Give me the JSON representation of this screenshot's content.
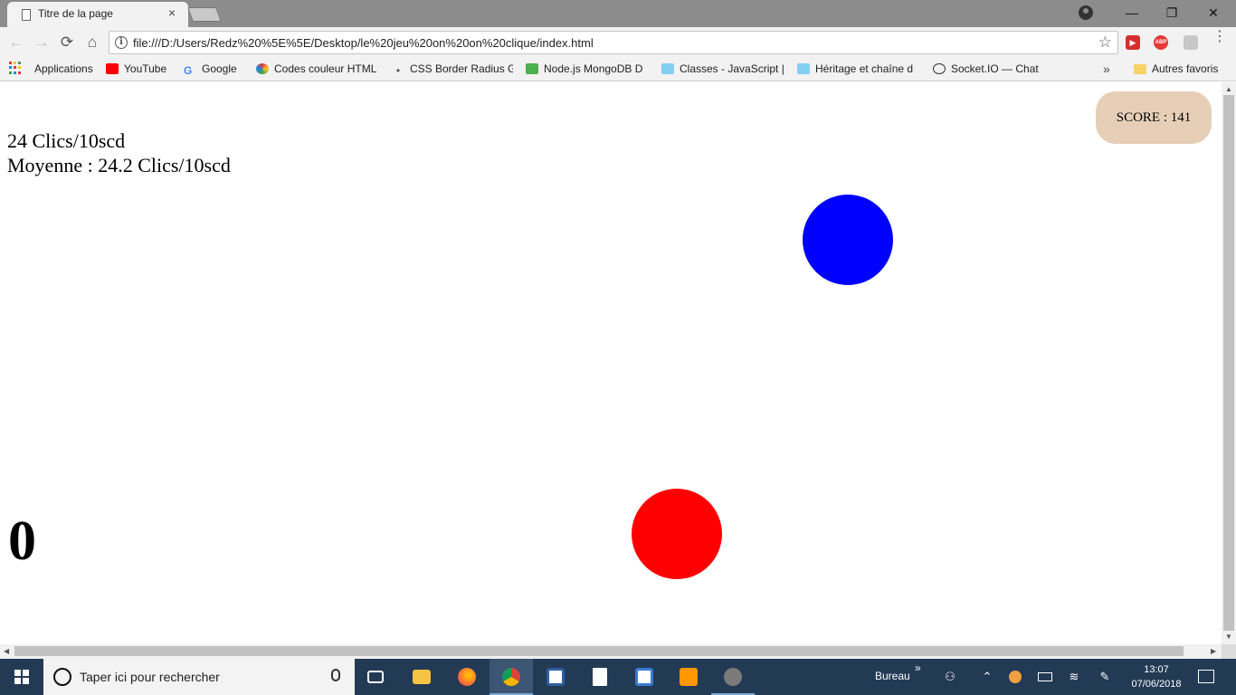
{
  "browser": {
    "tab_title": "Titre de la page",
    "tab_close": "×",
    "url": "file:///D:/Users/Redz%20%5E%5E/Desktop/le%20jeu%20on%20on%20clique/index.html",
    "win_minimize": "—",
    "win_restore": "❐",
    "win_close": "✕",
    "nav": {
      "back": "←",
      "forward": "→",
      "reload": "⟳",
      "home": "⌂"
    },
    "star": "☆",
    "ext_abp": "ABP",
    "ext_red": "▶",
    "menu": "⋮"
  },
  "bookmarks": {
    "items": [
      {
        "label": "Applications",
        "icon": "apps-grid-icon"
      },
      {
        "label": "YouTube",
        "icon": "youtube-icon",
        "color": "#ff0000"
      },
      {
        "label": "Google",
        "icon": "google-icon",
        "color": "#4285f4"
      },
      {
        "label": "Codes couleur HTML",
        "icon": "color-wheel-icon",
        "color": "#e53935"
      },
      {
        "label": "CSS Border Radius G",
        "icon": "dot-icon",
        "color": "#555555"
      },
      {
        "label": "Node.js MongoDB D",
        "icon": "w3schools-icon",
        "color": "#4caf50"
      },
      {
        "label": "Classes - JavaScript |",
        "icon": "mdn-icon",
        "color": "#83d0f2"
      },
      {
        "label": "Héritage et chaîne d",
        "icon": "mdn-icon",
        "color": "#83d0f2"
      },
      {
        "label": "Socket.IO — Chat",
        "icon": "socketio-icon",
        "color": "#333333"
      }
    ],
    "more": "»",
    "other": "Autres favoris"
  },
  "page": {
    "clicks_line": "24 Clics/10scd",
    "average_line": "Moyenne : 24.2 Clics/10scd",
    "score": "SCORE : 141",
    "counter": "0",
    "circles": [
      {
        "name": "blue-target-circle",
        "color": "#0000ff"
      },
      {
        "name": "red-target-circle",
        "color": "#ff0000"
      }
    ],
    "score_bg": "#e7cfb7"
  },
  "taskbar": {
    "search_placeholder": "Taper ici pour rechercher",
    "apps": [
      {
        "name": "task-view-icon",
        "color": "#ffffff"
      },
      {
        "name": "file-explorer-icon",
        "color": "#f6c344"
      },
      {
        "name": "firefox-icon",
        "color": "#ff7139"
      },
      {
        "name": "chrome-icon",
        "color": "#4caf50",
        "active": true
      },
      {
        "name": "qr-app-icon",
        "color": "#ffffff"
      },
      {
        "name": "notes-app-icon",
        "color": "#ffffff"
      },
      {
        "name": "sandbox-app-icon",
        "color": "#5aa0e0"
      },
      {
        "name": "sublime-text-icon",
        "color": "#ff9800"
      },
      {
        "name": "game-app-icon",
        "color": "#8a8a8a"
      }
    ],
    "desktop_label": "Bureau",
    "desktop_more": "»",
    "time": "13:07",
    "date": "07/06/2018"
  }
}
